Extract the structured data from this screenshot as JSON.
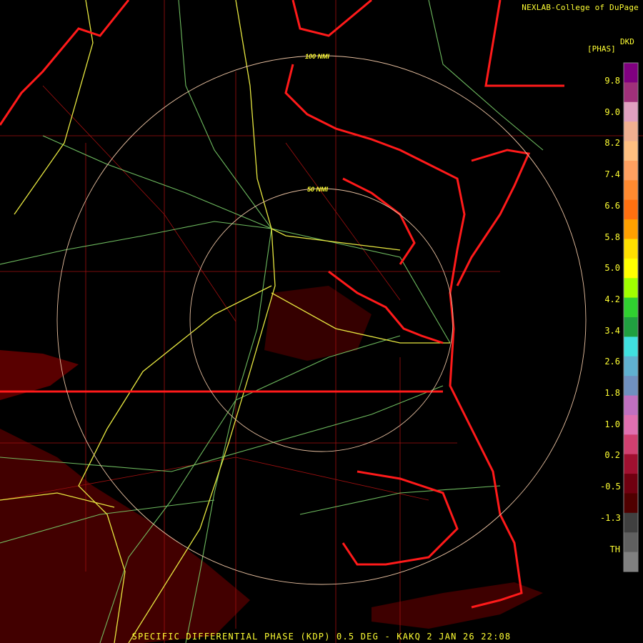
{
  "header": {
    "credit": "NEXLAB-College of DuPage",
    "product_code": "DKD",
    "unit": "[PHAS]"
  },
  "range_rings": [
    {
      "label": "50 NMI"
    },
    {
      "label": "100 NMI"
    }
  ],
  "color_scale": {
    "labels": [
      "9.8",
      "9.0",
      "8.2",
      "7.4",
      "6.6",
      "5.8",
      "5.0",
      "4.2",
      "3.4",
      "2.6",
      "1.8",
      "1.0",
      "0.2",
      "-0.5",
      "-1.3",
      "TH"
    ],
    "colors": [
      "#800080",
      "#a0307a",
      "#e0a0c0",
      "#f0b090",
      "#ffc080",
      "#ffa060",
      "#ff8a30",
      "#ff7010",
      "#ffa000",
      "#ffe000",
      "#ffff00",
      "#a0ff00",
      "#30d030",
      "#20a040",
      "#40e0e0",
      "#60b0d0",
      "#7090c0",
      "#c070c0",
      "#e070b0",
      "#d04070",
      "#a01030",
      "#700010",
      "#500000",
      "#404040",
      "#606060",
      "#808080"
    ]
  },
  "footer": {
    "caption": "SPECIFIC DIFFERENTIAL PHASE (KDP) 0.5 DEG - KAKQ 2 JAN 26 22:08"
  }
}
